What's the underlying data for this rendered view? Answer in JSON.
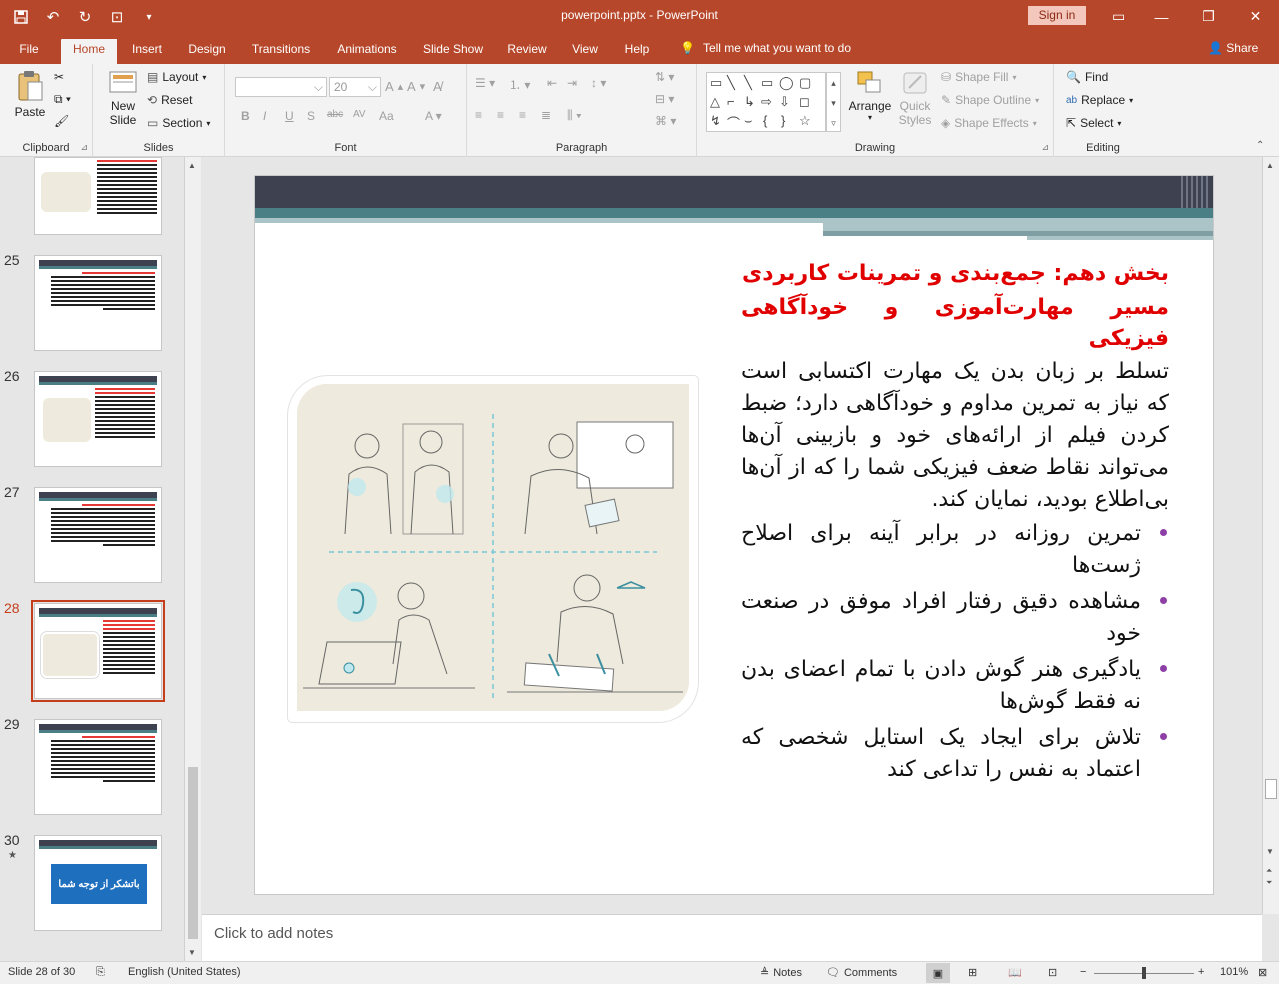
{
  "window": {
    "title": "powerpoint.pptx  -  PowerPoint",
    "signin_label": "Sign in",
    "qat": [
      "save-icon",
      "undo-icon",
      "redo-icon",
      "present-icon",
      "customize-icon"
    ]
  },
  "tabs": [
    "File",
    "Home",
    "Insert",
    "Design",
    "Transitions",
    "Animations",
    "Slide Show",
    "Review",
    "View",
    "Help"
  ],
  "active_tab": "Home",
  "tellme": "Tell me what you want to do",
  "share": "Share",
  "ribbon": {
    "clipboard": {
      "label": "Clipboard",
      "paste": "Paste"
    },
    "slides": {
      "label": "Slides",
      "new_slide": "New Slide",
      "new_slide_line1": "New",
      "new_slide_line2": "Slide",
      "layout": "Layout",
      "reset": "Reset",
      "section": "Section"
    },
    "font": {
      "label": "Font",
      "font_name": "",
      "font_size": "20"
    },
    "paragraph": {
      "label": "Paragraph"
    },
    "drawing": {
      "label": "Drawing",
      "arrange": "Arrange",
      "quick_styles": "Quick Styles",
      "quick_styles_line1": "Quick",
      "quick_styles_line2": "Styles",
      "shape_fill": "Shape Fill",
      "shape_outline": "Shape Outline",
      "shape_effects": "Shape Effects"
    },
    "editing": {
      "label": "Editing",
      "find": "Find",
      "replace": "Replace",
      "select": "Select"
    }
  },
  "thumbnails": [
    {
      "number": "",
      "selected": false
    },
    {
      "number": "25",
      "selected": false
    },
    {
      "number": "26",
      "selected": false
    },
    {
      "number": "27",
      "selected": false
    },
    {
      "number": "28",
      "selected": true
    },
    {
      "number": "29",
      "selected": false
    },
    {
      "number": "30",
      "selected": false,
      "thanks_text": "باتشکر از توجه شما"
    }
  ],
  "slide": {
    "heading1": "بخش دهم: جمع‌بندی و تمرینات کاربردی",
    "heading2": "مسیر مهارت‌آموزی و خودآگاهی فیزیکی",
    "paragraph": "تسلط بر زبان بدن یک مهارت اکتسابی است که نیاز به تمرین مداوم و خودآگاهی دارد؛ ضبط کردن فیلم از ارائه‌های خود و بازبینی آن‌ها می‌تواند نقاط ضعف فیزیکی شما را که از آن‌ها بی‌اطلاع بودید، نمایان کند.",
    "bullets": [
      "تمرین روزانه در برابر آینه برای اصلاح ژست‌ها",
      "مشاهده دقیق رفتار افراد موفق در صنعت خود",
      "یادگیری هنر گوش دادن با تمام اعضای بدن نه فقط گوش‌ها",
      "تلاش برای ایجاد یک استایل شخصی که اعتماد به نفس را تداعی کند"
    ]
  },
  "notes_placeholder": "Click to add notes",
  "status": {
    "slide_info": "Slide 28 of 30",
    "language": "English (United States)",
    "notes": "Notes",
    "comments": "Comments",
    "zoom": "101%"
  },
  "colors": {
    "brand": "#b7472a",
    "heading_red": "#e00000",
    "bullet": "#8e3fa6",
    "band_dark": "#3d4150",
    "band_teal": "#4a7f86"
  }
}
